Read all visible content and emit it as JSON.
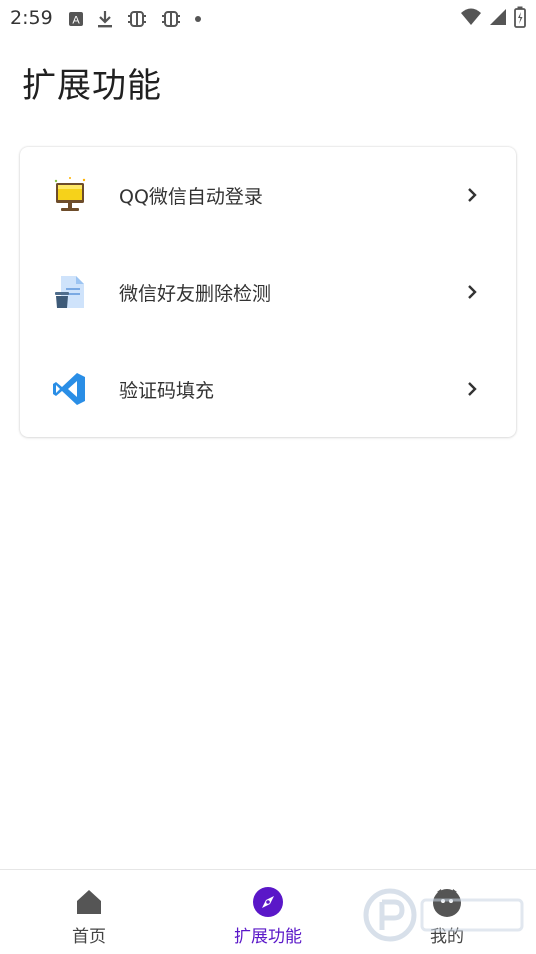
{
  "status_bar": {
    "time": "2:59",
    "left_icons": [
      "a-badge-icon",
      "download-icon",
      "bug-icon",
      "bug-icon",
      "dot-icon"
    ],
    "right_icons": [
      "wifi-icon",
      "signal-icon",
      "battery-icon"
    ]
  },
  "page": {
    "title": "扩展功能"
  },
  "features": [
    {
      "label": "QQ微信自动登录",
      "icon": "monitor-icon"
    },
    {
      "label": "微信好友删除检测",
      "icon": "document-trash-icon"
    },
    {
      "label": "验证码填充",
      "icon": "vscode-icon"
    }
  ],
  "bottom_nav": {
    "items": [
      {
        "label": "首页",
        "icon": "home-icon",
        "active": false
      },
      {
        "label": "扩展功能",
        "icon": "compass-icon",
        "active": true
      },
      {
        "label": "我的",
        "icon": "profile-icon",
        "active": false
      }
    ]
  },
  "colors": {
    "accent": "#5a17c8",
    "text_primary": "#202020",
    "icon_gray": "#444444"
  }
}
